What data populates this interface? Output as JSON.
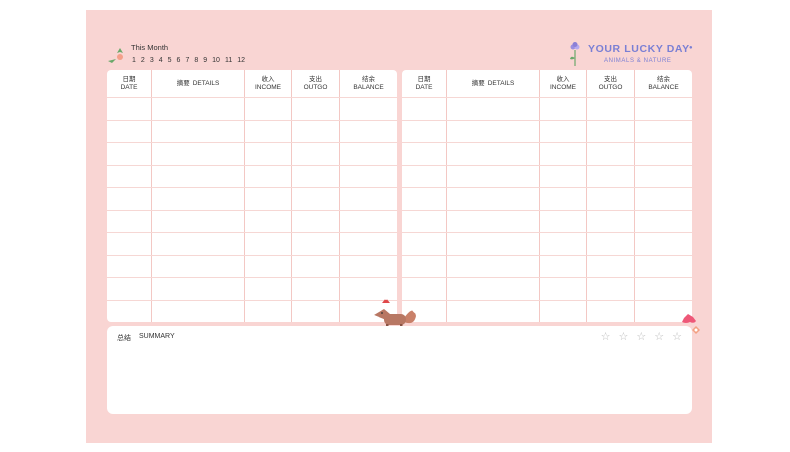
{
  "month_picker": {
    "label": "This Month",
    "months": [
      "1",
      "2",
      "3",
      "4",
      "5",
      "6",
      "7",
      "8",
      "9",
      "10",
      "11",
      "12"
    ]
  },
  "brand": {
    "title": "YOUR LUCKY DAY",
    "subtitle": "ANIMALS & NATURE",
    "color": "#7a7fd4"
  },
  "columns": [
    {
      "cn": "日期",
      "en": "DATE"
    },
    {
      "cn": "摘要",
      "en": "DETAILS"
    },
    {
      "cn": "收入",
      "en": "INCOME"
    },
    {
      "cn": "支出",
      "en": "OUTGO"
    },
    {
      "cn": "结余",
      "en": "BALANCE"
    }
  ],
  "summary": {
    "cn": "总结",
    "en": "SUMMARY",
    "stars": 5
  },
  "colors": {
    "background": "#f9d5d3",
    "grid": "#f3c8c4",
    "card": "#ffffff"
  }
}
